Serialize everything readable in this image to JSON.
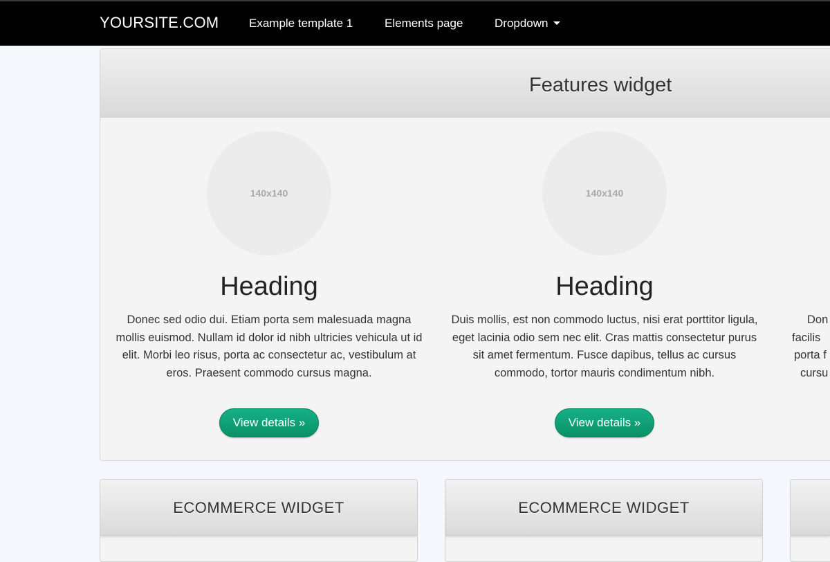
{
  "navbar": {
    "brand": "YOURSITE.COM",
    "links": [
      "Example template 1",
      "Elements page"
    ],
    "dropdown_label": "Dropdown"
  },
  "features": {
    "title": "Features widget",
    "items": [
      {
        "image_placeholder": "140x140",
        "heading": "Heading",
        "text": "Donec sed odio dui. Etiam porta sem malesuada magna mollis euismod. Nullam id dolor id nibh ultricies vehicula ut id elit. Morbi leo risus, porta ac consectetur ac, vestibulum at eros. Praesent commodo cursus magna.",
        "button": "View details »"
      },
      {
        "image_placeholder": "140x140",
        "heading": "Heading",
        "text": "Duis mollis, est non commodo luctus, nisi erat porttitor ligula, eget lacinia odio sem nec elit. Cras mattis consectetur purus sit amet fermentum. Fusce dapibus, tellus ac cursus commodo, tortor mauris condimentum nibh.",
        "button": "View details »"
      },
      {
        "text_lines": [
          "Don",
          "facilis",
          "porta f",
          "cursu"
        ]
      }
    ]
  },
  "ecommerce": {
    "widgets": [
      {
        "title": "ECOMMERCE WIDGET"
      },
      {
        "title": "ECOMMERCE WIDGET"
      }
    ]
  },
  "colors": {
    "navbar_bg": "#020202",
    "page_bg": "#f4f8fc",
    "button_green": "#0fa077"
  }
}
